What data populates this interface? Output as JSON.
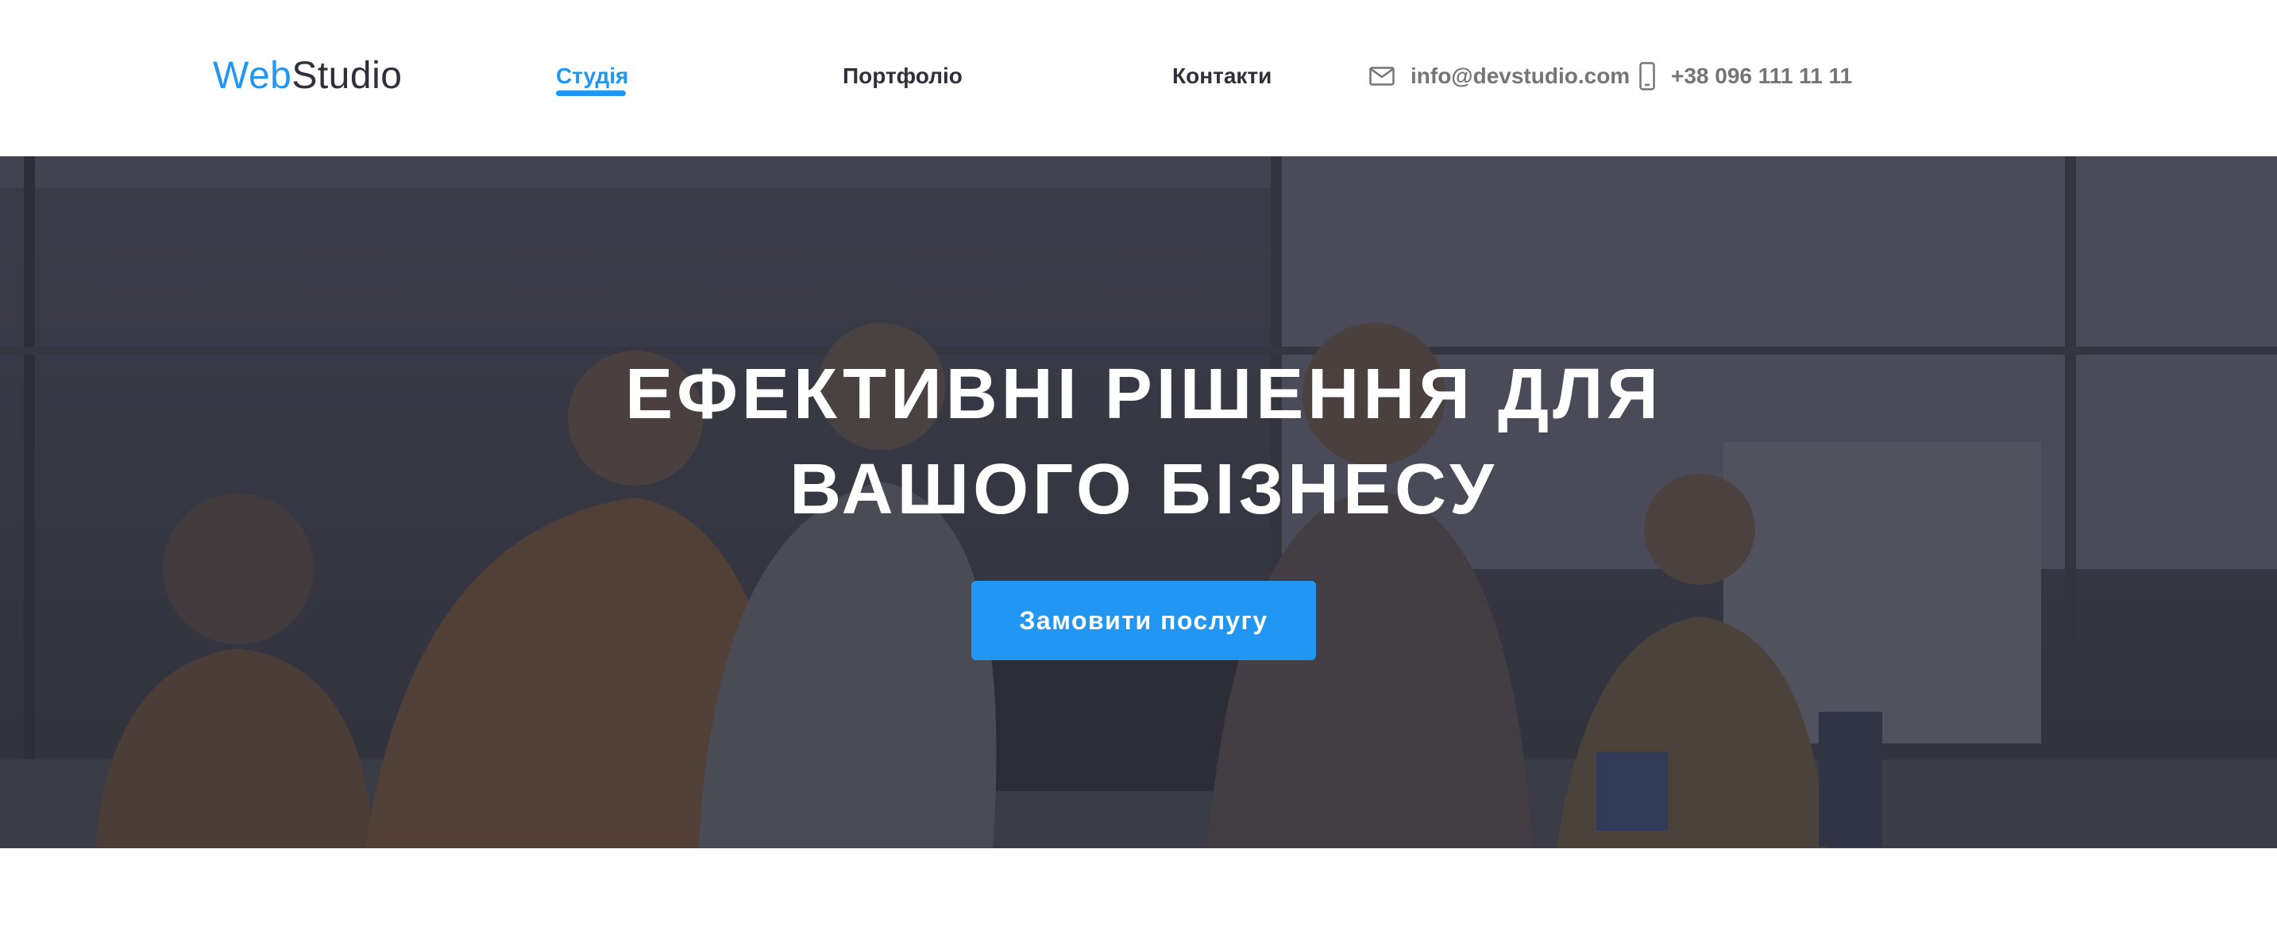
{
  "header": {
    "logo": {
      "part1": "Web",
      "part2": "Studio"
    },
    "nav": [
      {
        "label": "Студія",
        "active": true
      },
      {
        "label": "Портфоліо",
        "active": false
      },
      {
        "label": "Контакти",
        "active": false
      }
    ],
    "contacts": {
      "email": {
        "icon": "mail-icon",
        "text": "info@devstudio.com"
      },
      "phone": {
        "icon": "phone-icon",
        "text": "+38 096 111 11 11"
      }
    }
  },
  "hero": {
    "title_line1": "ЕФЕКТИВНІ РІШЕННЯ ДЛЯ",
    "title_line2": "ВАШОГО БІЗНЕСУ",
    "button_label": "Замовити послугу"
  },
  "colors": {
    "accent": "#2196f3",
    "text_dark": "#2f303a",
    "text_muted": "#757575",
    "overlay": "#2f303a"
  }
}
